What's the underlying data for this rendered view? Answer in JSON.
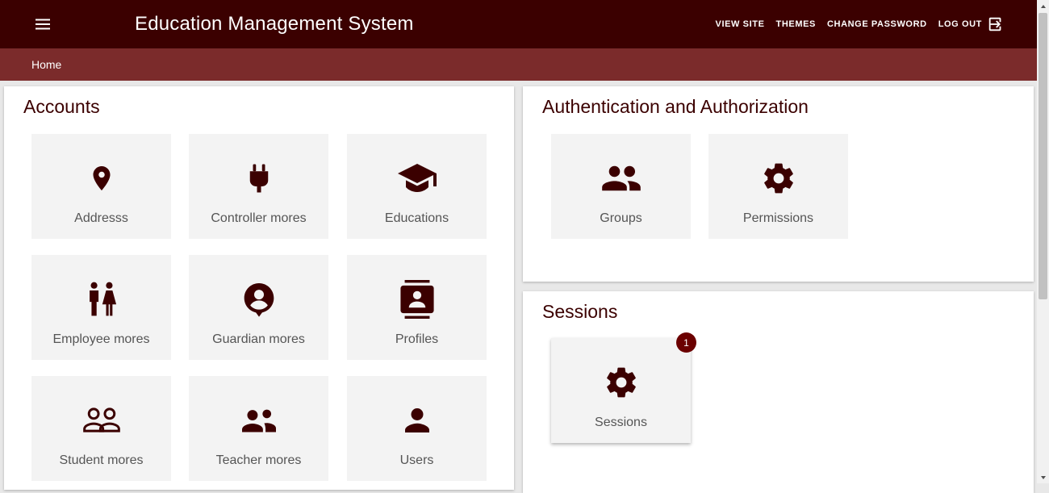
{
  "header": {
    "title": "Education Management System",
    "menu_icon": "menu-icon",
    "links": {
      "view_site": "VIEW SITE",
      "themes": "THEMES",
      "change_password": "CHANGE PASSWORD",
      "log_out": "LOG OUT"
    },
    "logout_icon": "logout-icon"
  },
  "breadcrumb": {
    "home": "Home"
  },
  "colors": {
    "topbar": "#3b0000",
    "breadcrumb_bar": "#7b2b2b",
    "icon": "#3b0000",
    "tile_bg": "#f3f3f3",
    "badge": "#6b0000"
  },
  "accounts": {
    "title": "Accounts",
    "tiles": [
      {
        "label": "Addresss",
        "icon": "map-pin-icon"
      },
      {
        "label": "Controller mores",
        "icon": "plug-icon"
      },
      {
        "label": "Educations",
        "icon": "graduation-cap-icon"
      },
      {
        "label": "Employee mores",
        "icon": "man-woman-icon"
      },
      {
        "label": "Guardian mores",
        "icon": "user-pin-icon"
      },
      {
        "label": "Profiles",
        "icon": "contact-card-icon"
      },
      {
        "label": "Student mores",
        "icon": "people-outline-icon"
      },
      {
        "label": "Teacher mores",
        "icon": "people-alt-icon"
      },
      {
        "label": "Users",
        "icon": "person-icon"
      }
    ]
  },
  "auth": {
    "title": "Authentication and Authorization",
    "tiles": [
      {
        "label": "Groups",
        "icon": "group-icon"
      },
      {
        "label": "Permissions",
        "icon": "gear-icon"
      }
    ]
  },
  "sessions": {
    "title": "Sessions",
    "tiles": [
      {
        "label": "Sessions",
        "icon": "gear-icon",
        "badge": "1"
      }
    ]
  }
}
